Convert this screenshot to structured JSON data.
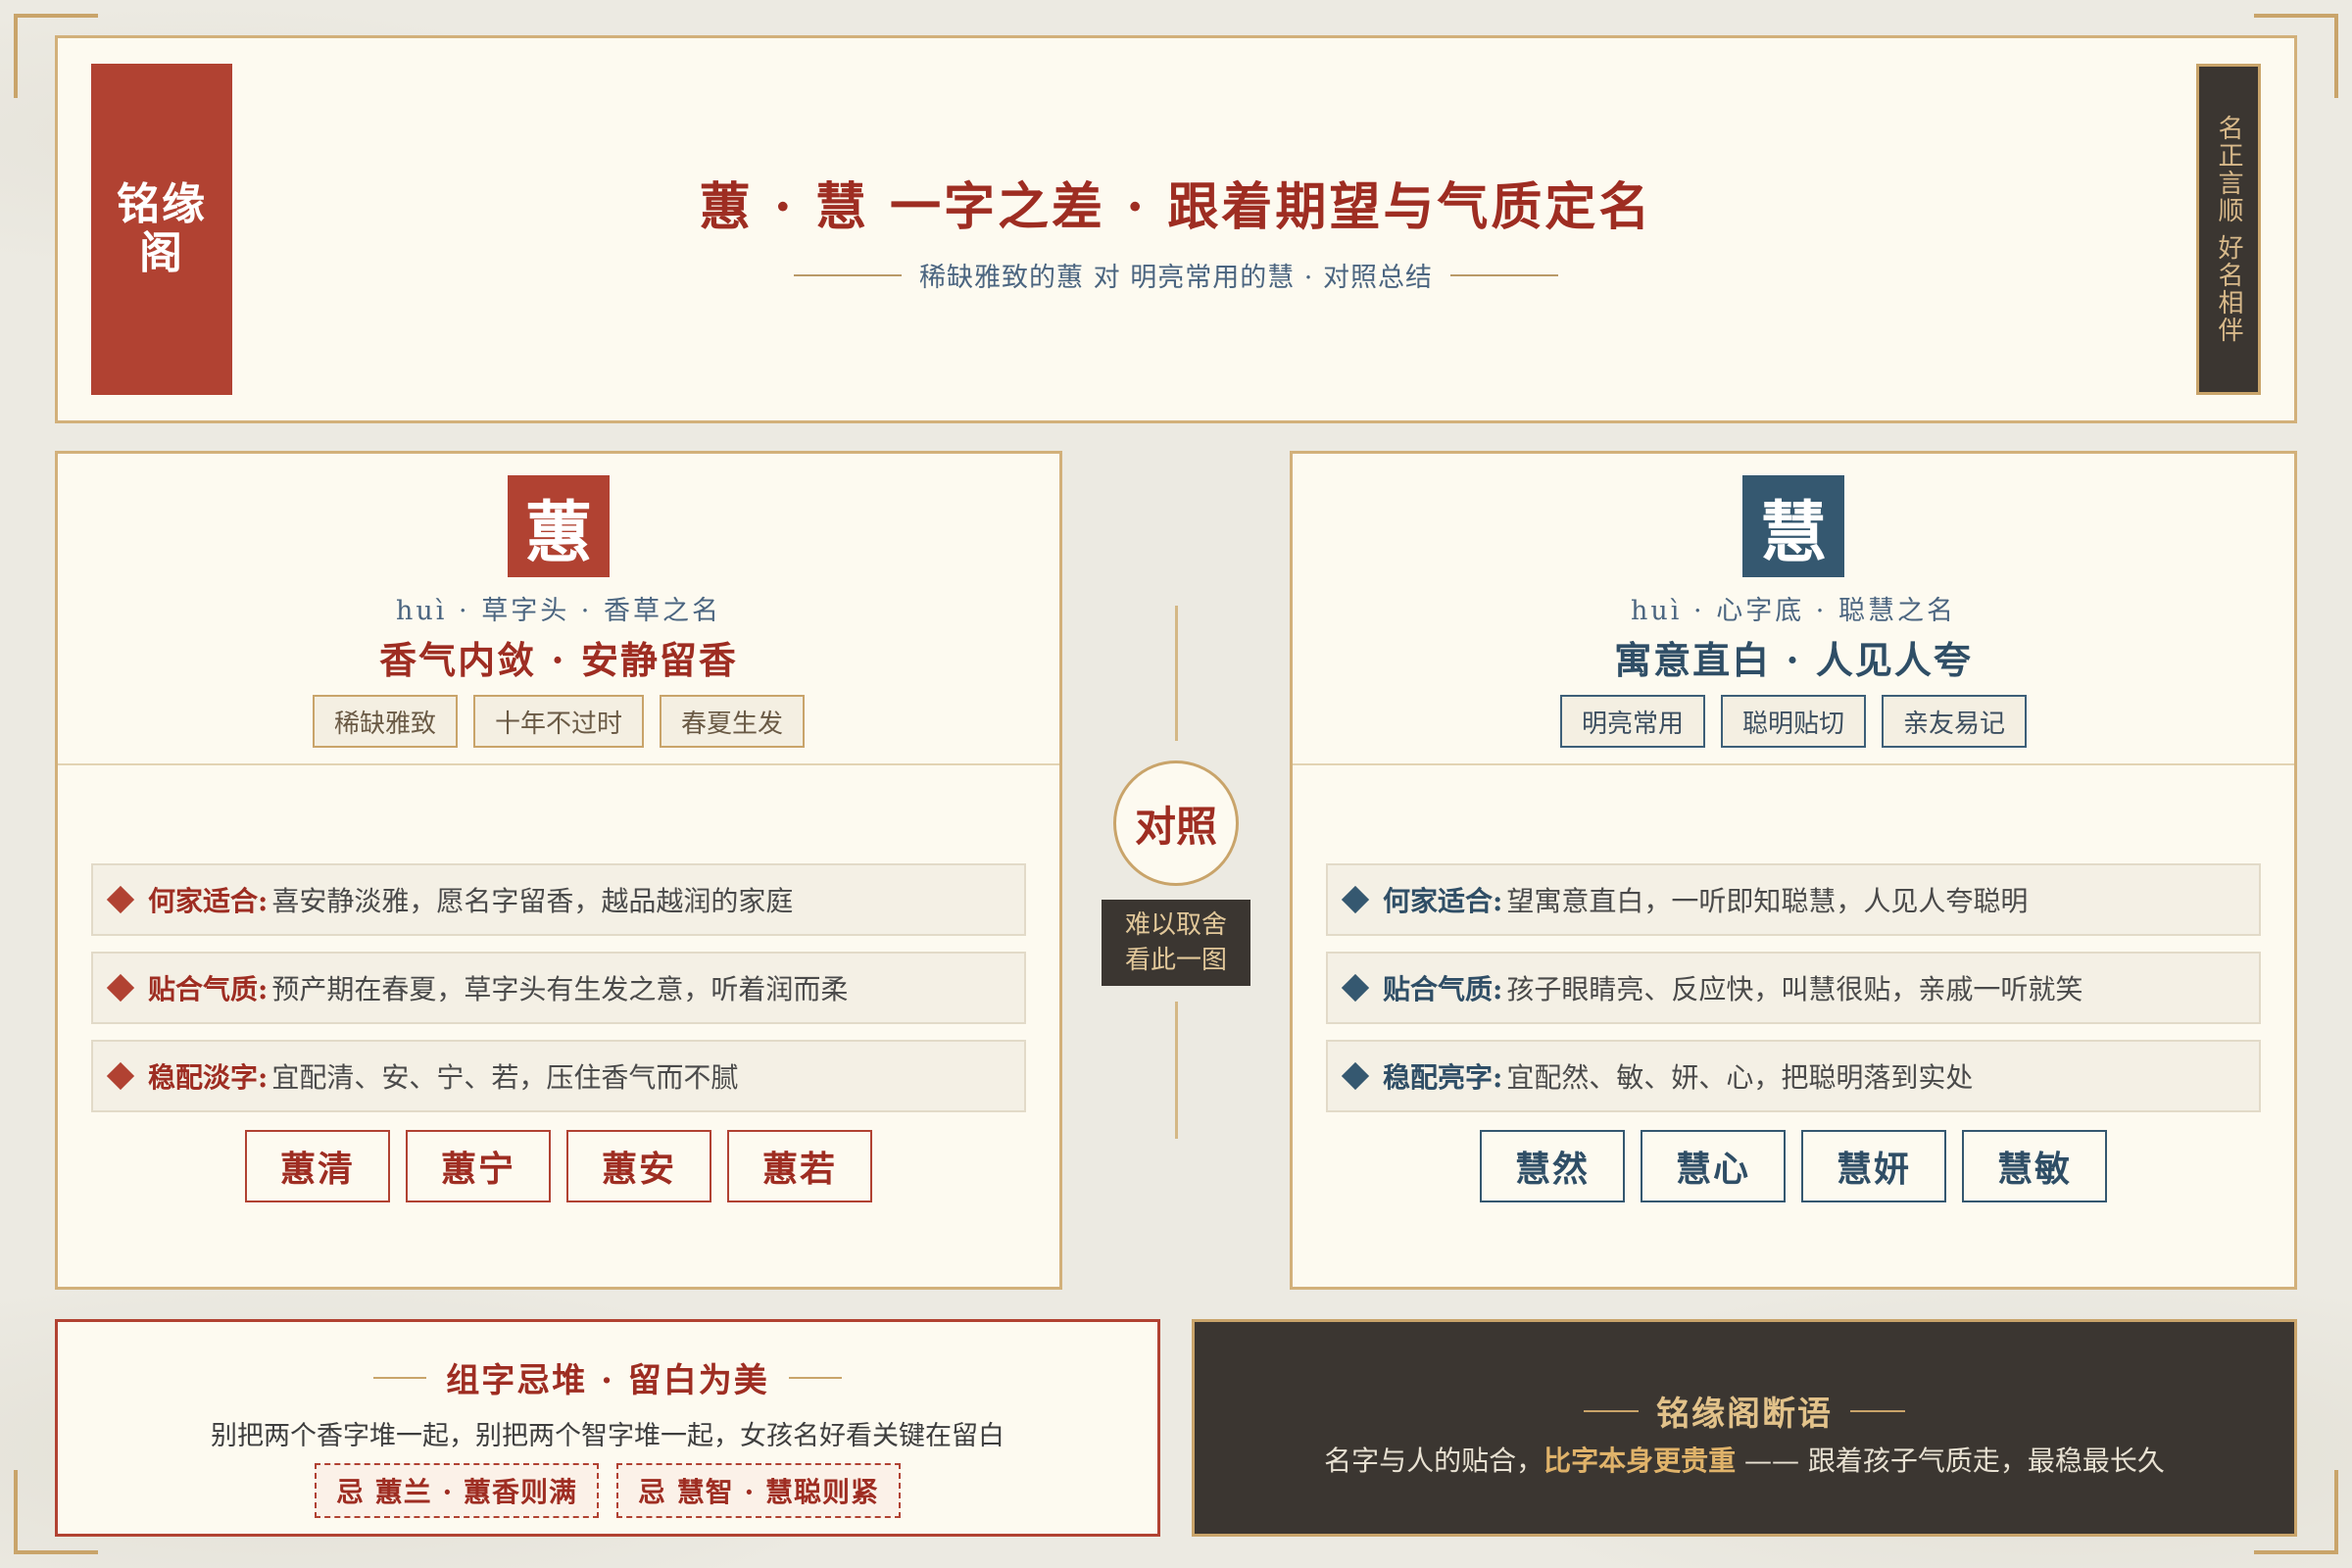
{
  "header": {
    "seal": "铭缘阁",
    "title": "蕙 · 慧 一字之差 · 跟着期望与气质定名",
    "subtitle": "稀缺雅致的蕙 对 明亮常用的慧 · 对照总结",
    "vertical_tag": "名正言顺 好名相伴"
  },
  "left": {
    "char": "蕙",
    "pinyin": "huì · 草字头 · 香草之名",
    "slogan": "香气内敛 · 安静留香",
    "tags": [
      "稀缺雅致",
      "十年不过时",
      "春夏生发"
    ],
    "rows": [
      {
        "key": "何家适合:",
        "text": "喜安静淡雅，愿名字留香，越品越润的家庭"
      },
      {
        "key": "贴合气质:",
        "text": "预产期在春夏，草字头有生发之意，听着润而柔"
      },
      {
        "key": "稳配淡字:",
        "text": "宜配清、安、宁、若，压住香气而不腻"
      }
    ],
    "names": [
      "蕙清",
      "蕙宁",
      "蕙安",
      "蕙若"
    ],
    "color": "#b14232"
  },
  "right": {
    "char": "慧",
    "pinyin": "huì · 心字底 · 聪慧之名",
    "slogan": "寓意直白 · 人见人夸",
    "tags": [
      "明亮常用",
      "聪明贴切",
      "亲友易记"
    ],
    "rows": [
      {
        "key": "何家适合:",
        "text": "望寓意直白，一听即知聪慧，人见人夸聪明"
      },
      {
        "key": "贴合气质:",
        "text": "孩子眼睛亮、反应快，叫慧很贴，亲戚一听就笑"
      },
      {
        "key": "稳配亮字:",
        "text": "宜配然、敏、妍、心，把聪明落到实处"
      }
    ],
    "names": [
      "慧然",
      "慧心",
      "慧妍",
      "慧敏"
    ],
    "color": "#355870"
  },
  "middle": {
    "circle": "对照",
    "tag_line1": "难以取舍",
    "tag_line2": "看此一图"
  },
  "bottom_left": {
    "title": "组字忌堆 · 留白为美",
    "desc": "别把两个香字堆一起，别把两个智字堆一起，女孩名好看关键在留白",
    "chips": [
      "忌 蕙兰 · 蕙香则满",
      "忌 慧智 · 慧聪则紧"
    ]
  },
  "bottom_right": {
    "title": "铭缘阁断语",
    "text_before": "名字与人的贴合，",
    "text_highlight": "比字本身更贵重",
    "text_after": " —— 跟着孩子气质走，最稳最长久"
  }
}
